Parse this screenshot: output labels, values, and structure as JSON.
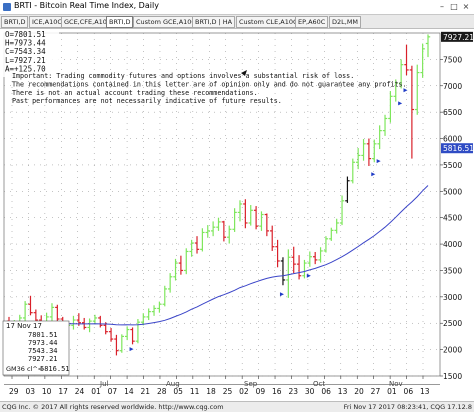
{
  "window": {
    "title": "BRTI - Bitcoin Real Time Index, Daily",
    "controls": [
      "–",
      "□",
      "×"
    ]
  },
  "tabs": [
    {
      "label": "BRTI,D",
      "active": false
    },
    {
      "label": "ICE,A10C",
      "active": false
    },
    {
      "label": "GCE,CFE,A10C",
      "active": false
    },
    {
      "label": "BRTI,D",
      "active": true
    },
    {
      "label": "Custom GCE,A10C",
      "active": false
    },
    {
      "label": "BRTI,D | HA",
      "active": false
    },
    {
      "label": "Custom CLE,A10C",
      "active": false
    },
    {
      "label": "EP,A60C",
      "active": false
    },
    {
      "label": "D2L,MM",
      "active": false
    }
  ],
  "ohlc_box": {
    "lines": [
      "O=7801.51",
      "H=7973.44",
      "C=7543.34",
      "L=7927.21",
      "A=+125.70"
    ]
  },
  "disclaimer": {
    "lines": [
      "Important: Trading commodity futures and options involves a substantial risk of loss.",
      "The recommendations contained in this letter are of opinion only and do not guarantee any profits.",
      "There is not an actual account trading these recommendations.",
      "Past performances are not necessarily indicative of future results."
    ]
  },
  "info_box": {
    "date": "17 Nov 17",
    "values": [
      "7801.51",
      "7973.44",
      "7543.34",
      "7927.21"
    ],
    "ma_label": "GM36 cl^=",
    "ma_value": "5816.51"
  },
  "price_tags": {
    "last": "7927.21",
    "ma": "5816.51"
  },
  "colors": {
    "up_bar": "#7ee65c",
    "down_bar": "#d9202a",
    "neutral_bar": "#111111",
    "moving_average": "#3b45c8",
    "signal_arrow": "#1f3cc6",
    "last_tag": "#1a1a1a",
    "ma_tag": "#2f4cc4",
    "grid": "#888888"
  },
  "footer": {
    "left": "CQG Inc. © 2017 All rights reserved worldwide. http://www.cqg.com",
    "right": "Fri Nov 17 2017 08:23:41, CQG 17.12.8"
  },
  "chart_data": {
    "type": "ohlc",
    "indicator": "moving average",
    "x_tick_labels": [
      "29",
      "03",
      "10",
      "17",
      "24",
      "01",
      "07",
      "14",
      "21",
      "28",
      "05",
      "11",
      "18",
      "25",
      "02",
      "09",
      "16",
      "23",
      "30",
      "06",
      "13",
      "20",
      "27",
      "01",
      "06",
      "13"
    ],
    "month_labels": [
      "Jul",
      "Aug",
      "Sep",
      "Oct",
      "Nov"
    ],
    "y_ticks": [
      1500,
      2000,
      2500,
      3000,
      3500,
      4000,
      4500,
      5000,
      5500,
      6000,
      6500,
      7000,
      7500
    ],
    "ylim": [
      1500,
      8000
    ],
    "grid": true,
    "signal_arrow_markers": 7,
    "ohlc": [
      {
        "o": 2540,
        "h": 2620,
        "l": 2380,
        "c": 2480
      },
      {
        "o": 2480,
        "h": 2560,
        "l": 2330,
        "c": 2520
      },
      {
        "o": 2520,
        "h": 2660,
        "l": 2430,
        "c": 2600
      },
      {
        "o": 2600,
        "h": 2920,
        "l": 2540,
        "c": 2860
      },
      {
        "o": 2860,
        "h": 3020,
        "l": 2650,
        "c": 2700
      },
      {
        "o": 2700,
        "h": 2760,
        "l": 2440,
        "c": 2560
      },
      {
        "o": 2560,
        "h": 2650,
        "l": 2300,
        "c": 2400
      },
      {
        "o": 2400,
        "h": 2700,
        "l": 2350,
        "c": 2620
      },
      {
        "o": 2620,
        "h": 2880,
        "l": 2540,
        "c": 2800
      },
      {
        "o": 2800,
        "h": 2850,
        "l": 2520,
        "c": 2580
      },
      {
        "o": 2580,
        "h": 2620,
        "l": 2260,
        "c": 2300
      },
      {
        "o": 2300,
        "h": 2520,
        "l": 2200,
        "c": 2460
      },
      {
        "o": 2460,
        "h": 2640,
        "l": 2380,
        "c": 2560
      },
      {
        "o": 2560,
        "h": 2690,
        "l": 2450,
        "c": 2510
      },
      {
        "o": 2510,
        "h": 2600,
        "l": 2380,
        "c": 2420
      },
      {
        "o": 2420,
        "h": 2590,
        "l": 2330,
        "c": 2540
      },
      {
        "o": 2540,
        "h": 2660,
        "l": 2480,
        "c": 2600
      },
      {
        "o": 2600,
        "h": 2640,
        "l": 2420,
        "c": 2460
      },
      {
        "o": 2460,
        "h": 2520,
        "l": 2290,
        "c": 2340
      },
      {
        "o": 2340,
        "h": 2410,
        "l": 2150,
        "c": 2200
      },
      {
        "o": 2200,
        "h": 2280,
        "l": 1890,
        "c": 1980
      },
      {
        "o": 1980,
        "h": 2290,
        "l": 1940,
        "c": 2250
      },
      {
        "o": 2250,
        "h": 2440,
        "l": 2180,
        "c": 2380
      },
      {
        "o": 2380,
        "h": 2420,
        "l": 2100,
        "c": 2160
      },
      {
        "o": 2160,
        "h": 2580,
        "l": 2120,
        "c": 2520
      },
      {
        "o": 2520,
        "h": 2690,
        "l": 2460,
        "c": 2620
      },
      {
        "o": 2620,
        "h": 2780,
        "l": 2560,
        "c": 2720
      },
      {
        "o": 2720,
        "h": 2840,
        "l": 2640,
        "c": 2780
      },
      {
        "o": 2780,
        "h": 2910,
        "l": 2700,
        "c": 2860
      },
      {
        "o": 2860,
        "h": 3210,
        "l": 2820,
        "c": 3150
      },
      {
        "o": 3150,
        "h": 3450,
        "l": 3080,
        "c": 3380
      },
      {
        "o": 3380,
        "h": 3720,
        "l": 3310,
        "c": 3640
      },
      {
        "o": 3640,
        "h": 3780,
        "l": 3420,
        "c": 3500
      },
      {
        "o": 3500,
        "h": 3920,
        "l": 3430,
        "c": 3860
      },
      {
        "o": 3860,
        "h": 4080,
        "l": 3760,
        "c": 4020
      },
      {
        "o": 4020,
        "h": 4150,
        "l": 3820,
        "c": 3900
      },
      {
        "o": 3900,
        "h": 4300,
        "l": 3860,
        "c": 4220
      },
      {
        "o": 4220,
        "h": 4360,
        "l": 4120,
        "c": 4250
      },
      {
        "o": 4250,
        "h": 4430,
        "l": 4150,
        "c": 4320
      },
      {
        "o": 4320,
        "h": 4500,
        "l": 4250,
        "c": 4420
      },
      {
        "o": 4420,
        "h": 4440,
        "l": 4050,
        "c": 4130
      },
      {
        "o": 4130,
        "h": 4350,
        "l": 4010,
        "c": 4280
      },
      {
        "o": 4280,
        "h": 4680,
        "l": 4230,
        "c": 4600
      },
      {
        "o": 4600,
        "h": 4830,
        "l": 4430,
        "c": 4760
      },
      {
        "o": 4760,
        "h": 4850,
        "l": 4300,
        "c": 4400
      },
      {
        "o": 4400,
        "h": 4740,
        "l": 4350,
        "c": 4640
      },
      {
        "o": 4640,
        "h": 4720,
        "l": 4280,
        "c": 4340
      },
      {
        "o": 4340,
        "h": 4620,
        "l": 4250,
        "c": 4560
      },
      {
        "o": 4560,
        "h": 4580,
        "l": 4150,
        "c": 4250
      },
      {
        "o": 4250,
        "h": 4350,
        "l": 3870,
        "c": 3950
      },
      {
        "o": 3950,
        "h": 4080,
        "l": 3560,
        "c": 3680
      },
      {
        "o": 3680,
        "h": 3750,
        "l": 3220,
        "c": 3320
      },
      {
        "o": 3320,
        "h": 3900,
        "l": 2980,
        "c": 3750
      },
      {
        "o": 3750,
        "h": 3950,
        "l": 3450,
        "c": 3620
      },
      {
        "o": 3620,
        "h": 3790,
        "l": 3330,
        "c": 3400
      },
      {
        "o": 3400,
        "h": 3700,
        "l": 3350,
        "c": 3640
      },
      {
        "o": 3640,
        "h": 3860,
        "l": 3570,
        "c": 3760
      },
      {
        "o": 3760,
        "h": 3850,
        "l": 3620,
        "c": 3700
      },
      {
        "o": 3700,
        "h": 3940,
        "l": 3650,
        "c": 3870
      },
      {
        "o": 3870,
        "h": 4150,
        "l": 3840,
        "c": 4100
      },
      {
        "o": 4100,
        "h": 4310,
        "l": 4060,
        "c": 4260
      },
      {
        "o": 4260,
        "h": 4480,
        "l": 4200,
        "c": 4400
      },
      {
        "o": 4400,
        "h": 4920,
        "l": 4360,
        "c": 4820
      },
      {
        "o": 4820,
        "h": 5280,
        "l": 4780,
        "c": 5200
      },
      {
        "o": 5200,
        "h": 5620,
        "l": 5150,
        "c": 5550
      },
      {
        "o": 5550,
        "h": 5820,
        "l": 5420,
        "c": 5680
      },
      {
        "o": 5680,
        "h": 5990,
        "l": 5580,
        "c": 5900
      },
      {
        "o": 5900,
        "h": 6000,
        "l": 5480,
        "c": 5620
      },
      {
        "o": 5620,
        "h": 5980,
        "l": 5550,
        "c": 5900
      },
      {
        "o": 5900,
        "h": 6250,
        "l": 5800,
        "c": 6150
      },
      {
        "o": 6150,
        "h": 6450,
        "l": 6050,
        "c": 6380
      },
      {
        "o": 6380,
        "h": 6900,
        "l": 6300,
        "c": 6800
      },
      {
        "o": 6800,
        "h": 7120,
        "l": 6700,
        "c": 7050
      },
      {
        "o": 7050,
        "h": 7500,
        "l": 6950,
        "c": 7400
      },
      {
        "o": 7400,
        "h": 7780,
        "l": 7200,
        "c": 7300
      },
      {
        "o": 7300,
        "h": 7380,
        "l": 5620,
        "c": 6550
      },
      {
        "o": 6550,
        "h": 7400,
        "l": 6450,
        "c": 7250
      },
      {
        "o": 7250,
        "h": 7800,
        "l": 7150,
        "c": 7700
      },
      {
        "o": 7801.51,
        "h": 7973.44,
        "l": 7543.34,
        "c": 7927.21
      }
    ],
    "moving_average": [
      2500,
      2495,
      2490,
      2490,
      2495,
      2495,
      2490,
      2490,
      2495,
      2500,
      2495,
      2490,
      2490,
      2488,
      2487,
      2488,
      2490,
      2488,
      2485,
      2480,
      2470,
      2468,
      2470,
      2468,
      2470,
      2480,
      2495,
      2512,
      2530,
      2555,
      2590,
      2630,
      2670,
      2715,
      2765,
      2810,
      2860,
      2910,
      2960,
      3005,
      3040,
      3080,
      3125,
      3175,
      3210,
      3250,
      3285,
      3320,
      3350,
      3375,
      3390,
      3400,
      3420,
      3440,
      3460,
      3480,
      3510,
      3540,
      3575,
      3610,
      3655,
      3705,
      3760,
      3820,
      3885,
      3955,
      4025,
      4090,
      4160,
      4240,
      4320,
      4410,
      4510,
      4610,
      4710,
      4800,
      4900,
      5010,
      5110
    ]
  }
}
